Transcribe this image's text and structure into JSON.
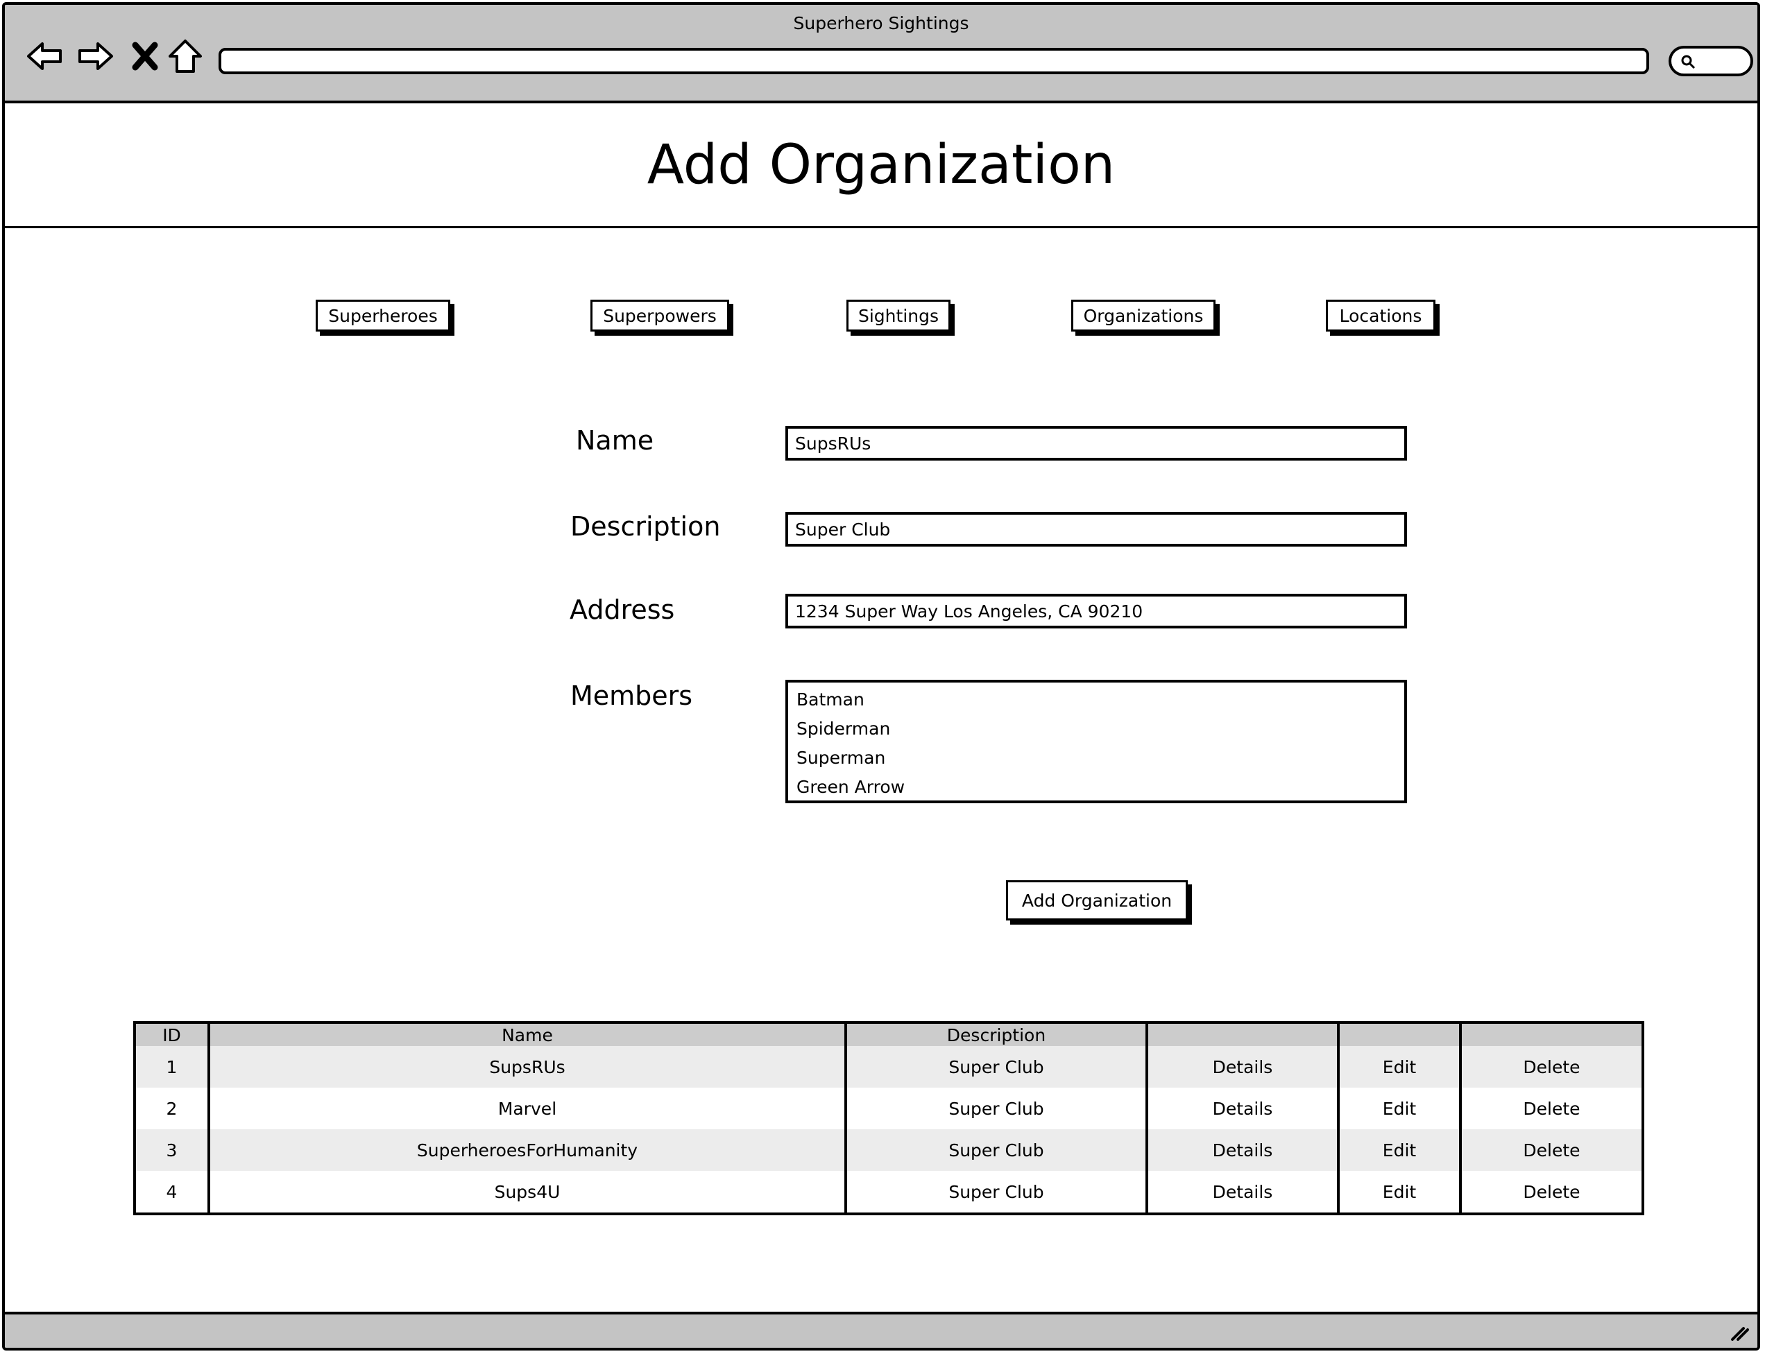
{
  "window": {
    "title": "Superhero Sightings"
  },
  "browser": {
    "icons": [
      "back-arrow-icon",
      "forward-arrow-icon",
      "close-x-icon",
      "home-icon",
      "search-icon",
      "resize-grip-icon"
    ],
    "url": ""
  },
  "page": {
    "title": "Add Organization"
  },
  "nav": {
    "superheroes": "Superheroes",
    "superpowers": "Superpowers",
    "sightings": "Sightings",
    "organizations": "Organizations",
    "locations": "Locations"
  },
  "form": {
    "name_label": "Name",
    "name_value": "SupsRUs",
    "description_label": "Description",
    "description_value": "Super Club",
    "address_label": "Address",
    "address_value": "1234 Super Way Los Angeles, CA 90210",
    "members_label": "Members",
    "members": [
      "Batman",
      "Spiderman",
      "Superman",
      "Green Arrow"
    ],
    "submit_label": "Add Organization"
  },
  "table": {
    "headers": [
      "ID",
      "Name",
      "Description",
      "",
      "",
      ""
    ],
    "rows": [
      {
        "id": "1",
        "name": "SupsRUs",
        "description": "Super Club",
        "details": "Details",
        "edit": "Edit",
        "delete": "Delete"
      },
      {
        "id": "2",
        "name": "Marvel",
        "description": "Super Club",
        "details": "Details",
        "edit": "Edit",
        "delete": "Delete"
      },
      {
        "id": "3",
        "name": "SuperheroesForHumanity",
        "description": "Super Club",
        "details": "Details",
        "edit": "Edit",
        "delete": "Delete"
      },
      {
        "id": "4",
        "name": "Sups4U",
        "description": "Super Club",
        "details": "Details",
        "edit": "Edit",
        "delete": "Delete"
      }
    ]
  },
  "colors": {
    "chrome": "#c4c4c4",
    "header_row": "#cccccc",
    "stripe": "#ececec",
    "ink": "#000000"
  }
}
